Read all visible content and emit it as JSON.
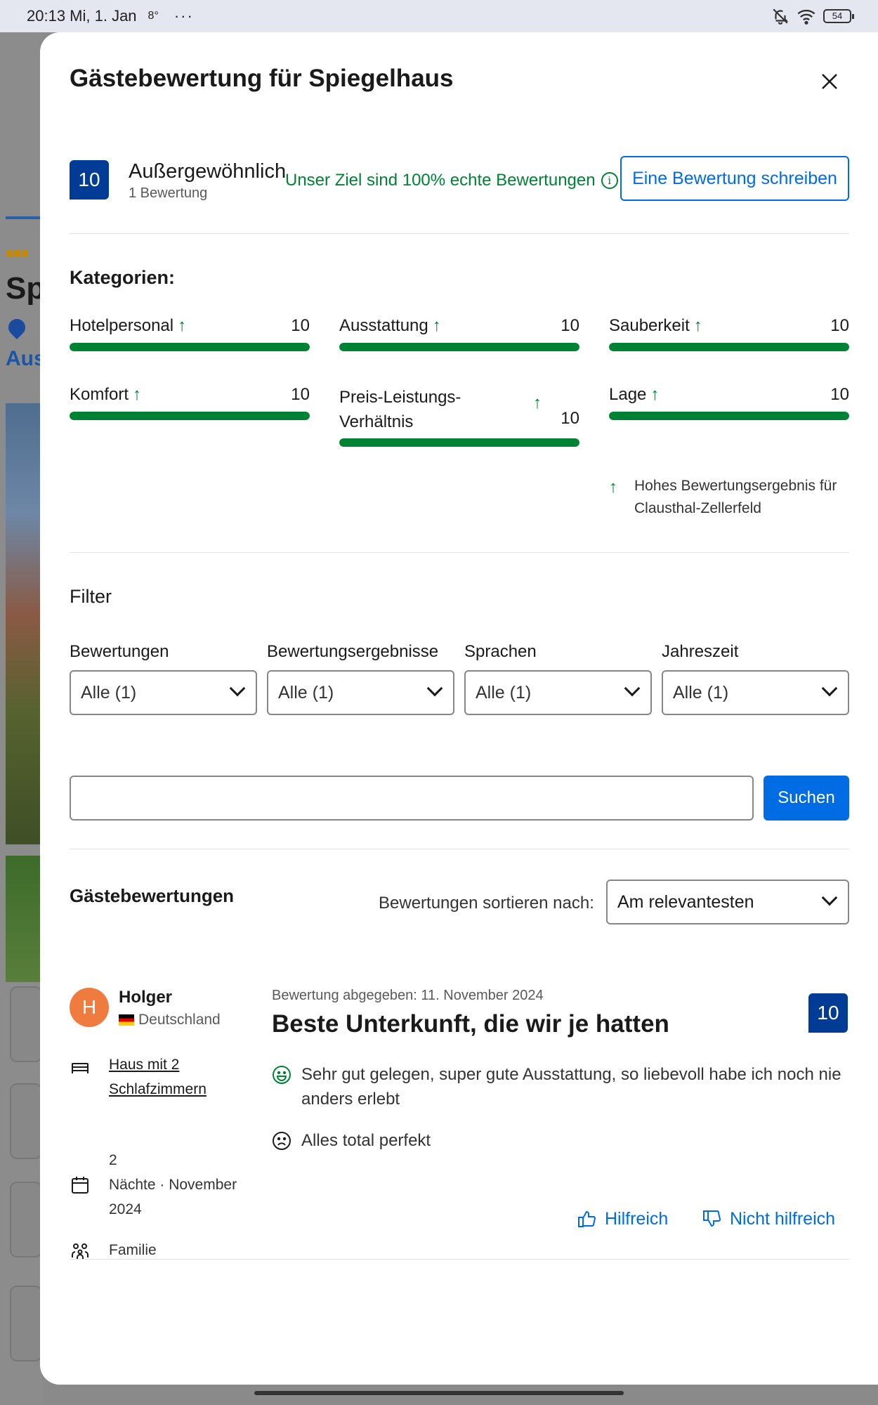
{
  "status_bar": {
    "time": "20:13 Mi, 1. Jan",
    "temp": "8°",
    "dots": "···",
    "battery": "54"
  },
  "background": {
    "title_fragment": "Sp",
    "link_fragment": "Aus"
  },
  "modal": {
    "title": "Gästebewertung für Spiegelhaus",
    "score": "10",
    "score_label": "Außergewöhnlich",
    "review_count": "1 Bewertung",
    "goal_text": "Unser Ziel sind 100% echte Bewertungen",
    "write_review": "Eine Bewertung schreiben"
  },
  "categories": {
    "heading": "Kategorien:",
    "items": [
      {
        "label": "Hotelpersonal",
        "score": "10",
        "fraction": 1.0
      },
      {
        "label": "Ausstattung",
        "score": "10",
        "fraction": 1.0
      },
      {
        "label": "Sauberkeit",
        "score": "10",
        "fraction": 1.0
      },
      {
        "label": "Komfort",
        "score": "10",
        "fraction": 1.0
      },
      {
        "label": "Preis-Leistungs-Verhältnis",
        "score": "10",
        "fraction": 1.0
      },
      {
        "label": "Lage",
        "score": "10",
        "fraction": 1.0
      }
    ],
    "high_score_note": "Hohes Bewertungsergebnis für Clausthal-Zellerfeld"
  },
  "filter": {
    "heading": "Filter",
    "columns": [
      {
        "label": "Bewertungen",
        "value": "Alle (1)"
      },
      {
        "label": "Bewertungsergebnisse",
        "value": "Alle (1)"
      },
      {
        "label": "Sprachen",
        "value": "Alle (1)"
      },
      {
        "label": "Jahreszeit",
        "value": "Alle (1)"
      }
    ],
    "search_value": "",
    "search_button": "Suchen"
  },
  "reviews": {
    "heading": "Gästebewertungen",
    "sort_label": "Bewertungen sortieren nach:",
    "sort_value": "Am relevantesten",
    "items": [
      {
        "initial": "H",
        "name": "Holger",
        "country": "Deutschland",
        "room_line1": "Haus mit 2",
        "room_line2": "Schlafzimmern",
        "nights_count": "2",
        "nights_line": "Nächte · November",
        "nights_year": "2024",
        "traveler_type": "Familie",
        "date": "Bewertung abgegeben: 11. November 2024",
        "title": "Beste Unterkunft, die wir je hatten",
        "score": "10",
        "positive": "Sehr gut gelegen, super gute Ausstattung, so liebevoll habe ich noch nie anders erlebt",
        "negative": "Alles total perfekt",
        "helpful": "Hilfreich",
        "not_helpful": "Nicht hilfreich"
      }
    ]
  },
  "colors": {
    "brand_blue": "#003b95",
    "action_blue": "#006ce4",
    "green": "#008234",
    "avatar": "#f07b3f"
  }
}
